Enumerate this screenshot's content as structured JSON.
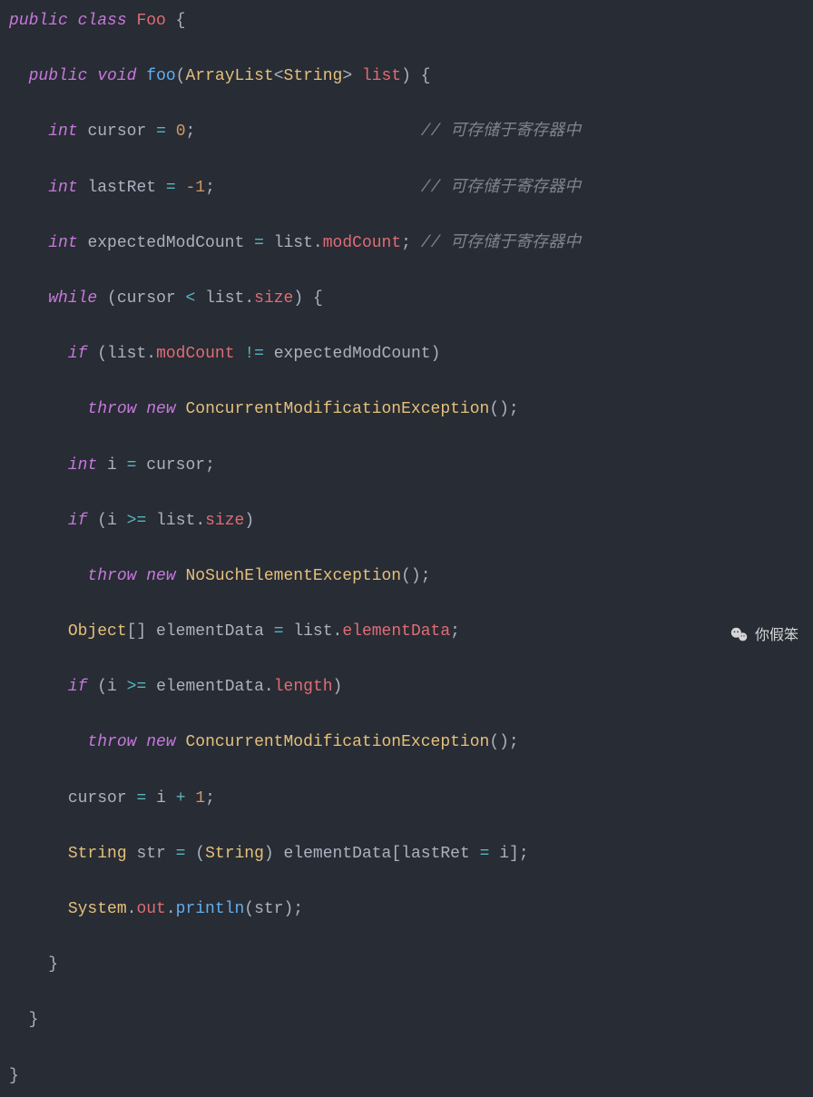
{
  "code": {
    "tokens": {
      "kw_public": "public",
      "kw_class": "class",
      "kw_void": "void",
      "kw_int": "int",
      "kw_while": "while",
      "kw_if": "if",
      "kw_throw": "throw",
      "kw_new": "new",
      "cls_foo": "Foo",
      "fn_foo": "foo",
      "type_arraylist": "ArrayList",
      "type_string": "String",
      "type_object": "Object",
      "type_system": "System",
      "param_list": "list",
      "var_cursor": "cursor",
      "var_lastret": "lastRet",
      "var_expected": "expectedModCount",
      "var_i": "i",
      "var_elementdata": "elementData",
      "var_str": "str",
      "mem_modcount": "modCount",
      "mem_size": "size",
      "mem_elementdata": "elementData",
      "mem_length": "length",
      "mem_out": "out",
      "fn_println": "println",
      "exc_cme": "ConcurrentModificationException",
      "exc_nsee": "NoSuchElementException",
      "num_zero": "0",
      "num_negone": "-1",
      "num_one": "1",
      "comment_reg": "// 可存储于寄存器中"
    }
  },
  "watermark": "你假笨"
}
